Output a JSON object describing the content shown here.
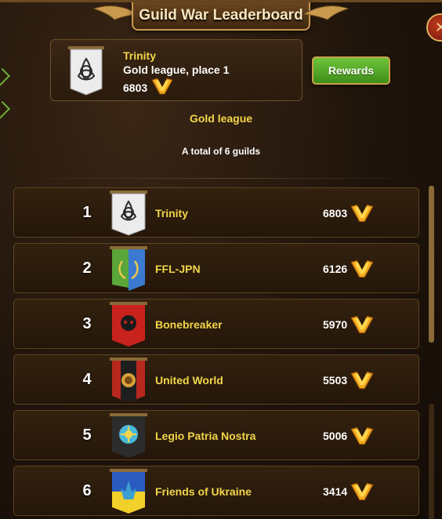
{
  "title": "Guild War Leaderboard",
  "header": {
    "guild_name": "Trinity",
    "league_place": "Gold league, place 1",
    "score": "6803",
    "rewards_label": "Rewards"
  },
  "league_label": "Gold league",
  "total_label": "A total of 6 guilds",
  "colors": {
    "gold_text": "#f2d64a",
    "reward_green": "#4fa626",
    "panel_brown": "#2a1b0d"
  },
  "guilds": [
    {
      "rank": "1",
      "name": "Trinity",
      "score": "6803",
      "banner": "white-celtic-knot"
    },
    {
      "rank": "2",
      "name": "FFL-JPN",
      "score": "6126",
      "banner": "green-blue-laurel"
    },
    {
      "rank": "3",
      "name": "Bonebreaker",
      "score": "5970",
      "banner": "red-skull"
    },
    {
      "rank": "4",
      "name": "United World",
      "score": "5503",
      "banner": "red-black-lion"
    },
    {
      "rank": "5",
      "name": "Legio Patria Nostra",
      "score": "5006",
      "banner": "black-sun"
    },
    {
      "rank": "6",
      "name": "Friends of Ukraine",
      "score": "3414",
      "banner": "blue-yellow-trident"
    }
  ]
}
